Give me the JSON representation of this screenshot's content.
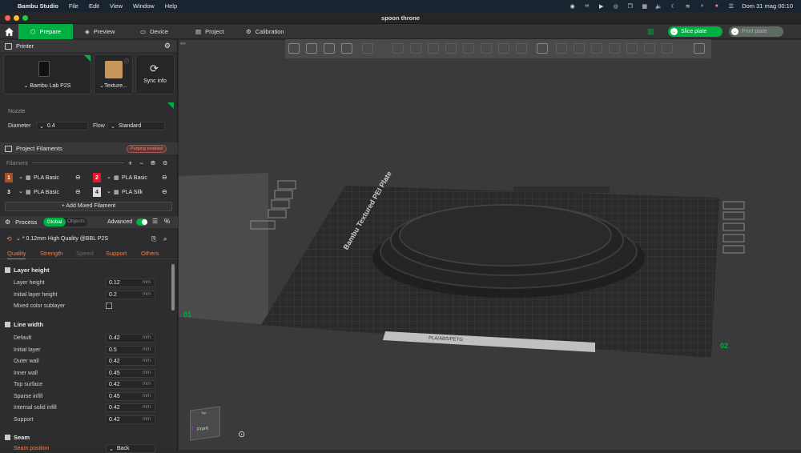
{
  "menubar": {
    "apple": "",
    "app": "Bambu Studio",
    "items": [
      "File",
      "Edit",
      "View",
      "Window",
      "Help"
    ],
    "datetime": "Dom 31 mag  00:10"
  },
  "window": {
    "title": "spoon throne"
  },
  "tabs": {
    "prepare": "Prepare",
    "preview": "Preview",
    "device": "Device",
    "project": "Project",
    "calibration": "Calibration"
  },
  "actions": {
    "slice": "Slice plate",
    "print": "Print plate"
  },
  "printer": {
    "header": "Printer",
    "name": "Bambu Lab P2S",
    "plate": "Texture...",
    "sync": "Sync info",
    "nozzle_label": "Nozzle",
    "diameter_label": "Diameter",
    "diameter": "0.4",
    "flow_label": "Flow",
    "flow": "Standard"
  },
  "filaments": {
    "header": "Project Filaments",
    "badge": "Purging enabled",
    "filament_label": "Filament",
    "items": [
      {
        "num": "1",
        "name": "PLA Basic",
        "color": "#a0522d"
      },
      {
        "num": "2",
        "name": "PLA Basic",
        "color": "#e0182b"
      },
      {
        "num": "3",
        "name": "PLA Basic",
        "color": "#2a2a2a"
      },
      {
        "num": "4",
        "name": "PLA Silk",
        "color": "#dcdcdc"
      }
    ],
    "add_mixed": "+ Add Mixed Filament"
  },
  "process": {
    "header": "Process",
    "global": "Global",
    "objects": "Objects",
    "advanced": "Advanced",
    "preset": "* 0.12mm High Quality @BBL P2S",
    "tabs": [
      "Quality",
      "Strength",
      "Speed",
      "Support",
      "Others"
    ],
    "layer_height": {
      "title": "Layer height",
      "rows": [
        {
          "label": "Layer height",
          "value": "0.12",
          "unit": "mm"
        },
        {
          "label": "Initial layer height",
          "value": "0.2",
          "unit": "mm"
        }
      ],
      "mixed": "Mixed color sublayer"
    },
    "line_width": {
      "title": "Line width",
      "rows": [
        {
          "label": "Default",
          "value": "0.42",
          "unit": "mm"
        },
        {
          "label": "Initial layer",
          "value": "0.5",
          "unit": "mm"
        },
        {
          "label": "Outer wall",
          "value": "0.42",
          "unit": "mm"
        },
        {
          "label": "Inner wall",
          "value": "0.45",
          "unit": "mm"
        },
        {
          "label": "Top surface",
          "value": "0.42",
          "unit": "mm"
        },
        {
          "label": "Sparse infill",
          "value": "0.45",
          "unit": "mm"
        },
        {
          "label": "Internal solid infill",
          "value": "0.42",
          "unit": "mm"
        },
        {
          "label": "Support",
          "value": "0.42",
          "unit": "mm"
        }
      ]
    },
    "seam": {
      "title": "Seam",
      "row_label": "Seam position",
      "row_value": "Back"
    }
  },
  "viewport": {
    "plate_label": "Bambu Textured PEI Plate",
    "plate_num_left": "01",
    "plate_num_right": "02",
    "cube": "Front",
    "cube_top": "Top",
    "strip": "PLA/ABS/PETG"
  }
}
